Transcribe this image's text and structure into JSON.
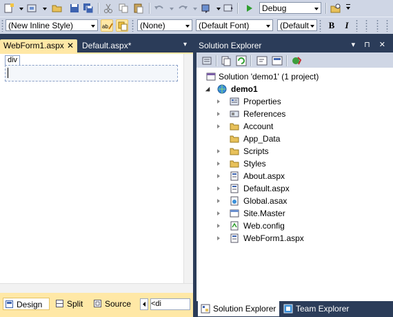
{
  "toolbar1": {
    "config_value": "Debug"
  },
  "toolbar2": {
    "style_value": "(New Inline Style)",
    "target_value": "(None)",
    "font_value": "(Default Font)",
    "size_value": "(Default",
    "bold_label": "B",
    "italic_label": "I"
  },
  "editor": {
    "tabs": [
      {
        "label": "WebForm1.aspx",
        "close": "✕"
      },
      {
        "label": "Default.aspx*"
      }
    ],
    "tab_overflow": "▾",
    "div_tag": "div",
    "views": {
      "design": "Design",
      "split": "Split",
      "source": "Source"
    },
    "tag_nav": "<di"
  },
  "solution_explorer": {
    "title": "Solution Explorer",
    "title_icons": "▾ ⊓ ✕",
    "tree": [
      {
        "label": "Solution 'demo1' (1 project)",
        "icon": "solution-icon",
        "expander": "none"
      },
      {
        "label": "demo1",
        "icon": "web-project-icon",
        "expander": "open",
        "bold": true
      },
      {
        "label": "Properties",
        "icon": "properties-icon",
        "expander": "closed"
      },
      {
        "label": "References",
        "icon": "references-icon",
        "expander": "closed"
      },
      {
        "label": "Account",
        "icon": "folder-icon",
        "expander": "closed"
      },
      {
        "label": "App_Data",
        "icon": "folder-icon",
        "expander": "none"
      },
      {
        "label": "Scripts",
        "icon": "folder-icon",
        "expander": "closed"
      },
      {
        "label": "Styles",
        "icon": "folder-icon",
        "expander": "closed"
      },
      {
        "label": "About.aspx",
        "icon": "aspx-file-icon",
        "expander": "closed"
      },
      {
        "label": "Default.aspx",
        "icon": "aspx-file-icon",
        "expander": "closed"
      },
      {
        "label": "Global.asax",
        "icon": "global-asax-icon",
        "expander": "closed"
      },
      {
        "label": "Site.Master",
        "icon": "master-page-icon",
        "expander": "closed"
      },
      {
        "label": "Web.config",
        "icon": "config-file-icon",
        "expander": "closed"
      },
      {
        "label": "WebForm1.aspx",
        "icon": "aspx-file-icon",
        "expander": "closed"
      }
    ],
    "bottom_tabs": {
      "solution": "Solution Explorer",
      "team": "Team Explorer"
    }
  },
  "colors": {
    "ide_background": "#2b3c59",
    "toolbar": "#cfd6e5",
    "active_tab": "#ffe8a6",
    "folder": "#e8c15a"
  }
}
